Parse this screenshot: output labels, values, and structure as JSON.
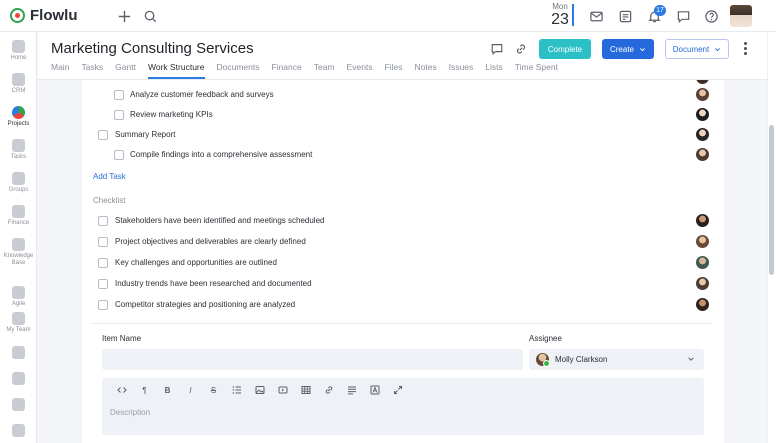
{
  "app": {
    "name": "Flowlu"
  },
  "topbar": {
    "date_dow": "Mon",
    "date_day": "23",
    "notification_count": "17"
  },
  "sidebar": {
    "items": [
      {
        "label": "Home",
        "icon": "home-icon"
      },
      {
        "label": "CRM",
        "icon": "crm-icon"
      },
      {
        "label": "Projects",
        "icon": "projects-icon",
        "active": true
      },
      {
        "label": "Tasks",
        "icon": "tasks-icon"
      },
      {
        "label": "Groups",
        "icon": "groups-icon"
      },
      {
        "label": "Finance",
        "icon": "finance-icon"
      },
      {
        "label": "Knowledge Base",
        "icon": "knowledge-base-icon"
      },
      {
        "label": "Agile",
        "icon": "agile-icon"
      },
      {
        "label": "My Team",
        "icon": "team-icon"
      }
    ]
  },
  "project": {
    "title": "Marketing Consulting Services",
    "tabs": [
      "Main",
      "Tasks",
      "Gantt",
      "Work Structure",
      "Documents",
      "Finance",
      "Team",
      "Events",
      "Files",
      "Notes",
      "Issues",
      "Lists",
      "Time Spent"
    ],
    "active_tab": "Work Structure",
    "complete_label": "Complete",
    "create_label": "Create",
    "document_label": "Document"
  },
  "tasks": [
    {
      "text": "Analyze customer feedback and surveys",
      "indent": true
    },
    {
      "text": "Review marketing KPIs",
      "indent": true
    },
    {
      "text": "Summary Report",
      "indent": false
    },
    {
      "text": "Compile findings into a comprehensive assessment",
      "indent": true
    }
  ],
  "add_task_label": "Add Task",
  "checklist": {
    "label": "Checklist",
    "items": [
      "Stakeholders have been identified and meetings scheduled",
      "Project objectives and deliverables are clearly defined",
      "Key challenges and opportunities are outlined",
      "Industry trends have been researched and documented",
      "Competitor strategies and positioning are analyzed"
    ]
  },
  "form": {
    "item_name_label": "Item Name",
    "assignee_label": "Assignee",
    "assignee_value": "Molly Clarkson",
    "description_placeholder": "Description"
  },
  "colors": {
    "accent": "#2569dc",
    "complete": "#2bc0c6",
    "link": "#2a6fd6"
  }
}
